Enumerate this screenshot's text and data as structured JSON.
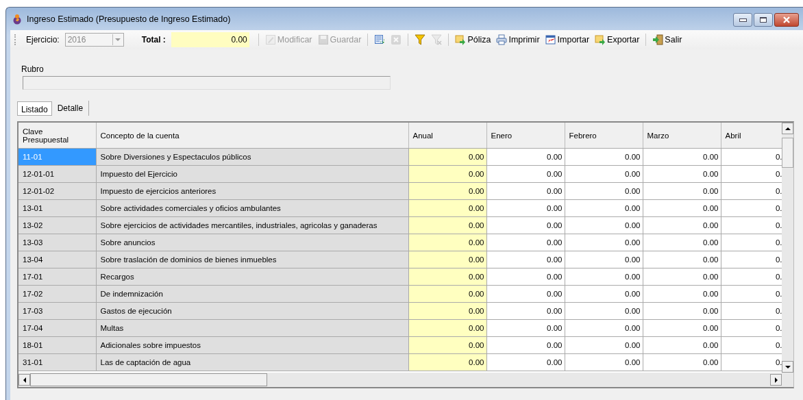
{
  "window": {
    "title": "Ingreso Estimado (Presupuesto de Ingreso Estimado)"
  },
  "toolbar": {
    "ejercicio": {
      "label": "Ejercicio:",
      "value": "2016",
      "disabled": true
    },
    "total": {
      "label": "Total :",
      "value": "0.00"
    },
    "items": [
      {
        "kind": "edit",
        "label": "Modificar",
        "disabled": true
      },
      {
        "kind": "save",
        "label": "Guardar",
        "disabled": true
      },
      {
        "kind": "separator"
      },
      {
        "kind": "refresh",
        "disabled": false
      },
      {
        "kind": "cancel",
        "disabled": true
      },
      {
        "kind": "separator"
      },
      {
        "kind": "filter",
        "disabled": false
      },
      {
        "kind": "clear-filter",
        "disabled": true
      },
      {
        "kind": "separator"
      },
      {
        "kind": "export",
        "label": "Póliza",
        "disabled": false
      },
      {
        "kind": "print",
        "label": "Imprimir",
        "disabled": false
      },
      {
        "kind": "import",
        "label": "Importar",
        "disabled": false
      },
      {
        "kind": "export",
        "label": "Exportar",
        "disabled": false
      },
      {
        "kind": "separator"
      },
      {
        "kind": "exit",
        "label": "Salir",
        "disabled": false
      }
    ]
  },
  "rubro": {
    "label": "Rubro"
  },
  "tabs": [
    {
      "label": "Listado",
      "selected": true
    },
    {
      "label": "Detalle",
      "selected": false
    }
  ],
  "table": {
    "columns": [
      "Clave\nPresupuestal",
      "Concepto de la cuenta",
      "Anual",
      "Enero",
      "Febrero",
      "Marzo",
      "Abril"
    ],
    "rows": [
      {
        "clave": "11-01",
        "concepto": "Sobre Diversiones y Espectaculos públicos",
        "values": [
          "0.00",
          "0.00",
          "0.00",
          "0.00",
          "0."
        ],
        "selected": true
      },
      {
        "clave": "12-01-01",
        "concepto": "Impuesto del Ejercicio",
        "values": [
          "0.00",
          "0.00",
          "0.00",
          "0.00",
          "0."
        ],
        "selected": false
      },
      {
        "clave": "12-01-02",
        "concepto": "Impuesto de ejercicios anteriores",
        "values": [
          "0.00",
          "0.00",
          "0.00",
          "0.00",
          "0."
        ],
        "selected": false
      },
      {
        "clave": "13-01",
        "concepto": "Sobre actividades comerciales y oficios ambulantes",
        "values": [
          "0.00",
          "0.00",
          "0.00",
          "0.00",
          "0."
        ],
        "selected": false
      },
      {
        "clave": "13-02",
        "concepto": "Sobre ejercicios de actividades mercantiles, industriales, agricolas y ganaderas",
        "values": [
          "0.00",
          "0.00",
          "0.00",
          "0.00",
          "0."
        ],
        "selected": false
      },
      {
        "clave": "13-03",
        "concepto": "Sobre anuncios",
        "values": [
          "0.00",
          "0.00",
          "0.00",
          "0.00",
          "0."
        ],
        "selected": false
      },
      {
        "clave": "13-04",
        "concepto": "Sobre traslación de dominios de bienes inmuebles",
        "values": [
          "0.00",
          "0.00",
          "0.00",
          "0.00",
          "0."
        ],
        "selected": false
      },
      {
        "clave": "17-01",
        "concepto": "Recargos",
        "values": [
          "0.00",
          "0.00",
          "0.00",
          "0.00",
          "0."
        ],
        "selected": false
      },
      {
        "clave": "17-02",
        "concepto": "De indemnización",
        "values": [
          "0.00",
          "0.00",
          "0.00",
          "0.00",
          "0."
        ],
        "selected": false
      },
      {
        "clave": "17-03",
        "concepto": "Gastos de ejecución",
        "values": [
          "0.00",
          "0.00",
          "0.00",
          "0.00",
          "0."
        ],
        "selected": false
      },
      {
        "clave": "17-04",
        "concepto": "Multas",
        "values": [
          "0.00",
          "0.00",
          "0.00",
          "0.00",
          "0."
        ],
        "selected": false
      },
      {
        "clave": "18-01",
        "concepto": "Adicionales sobre impuestos",
        "values": [
          "0.00",
          "0.00",
          "0.00",
          "0.00",
          "0."
        ],
        "selected": false
      },
      {
        "clave": "31-01",
        "concepto": "Las de captación de agua",
        "values": [
          "0.00",
          "0.00",
          "0.00",
          "0.00",
          "0."
        ],
        "selected": false
      }
    ]
  }
}
